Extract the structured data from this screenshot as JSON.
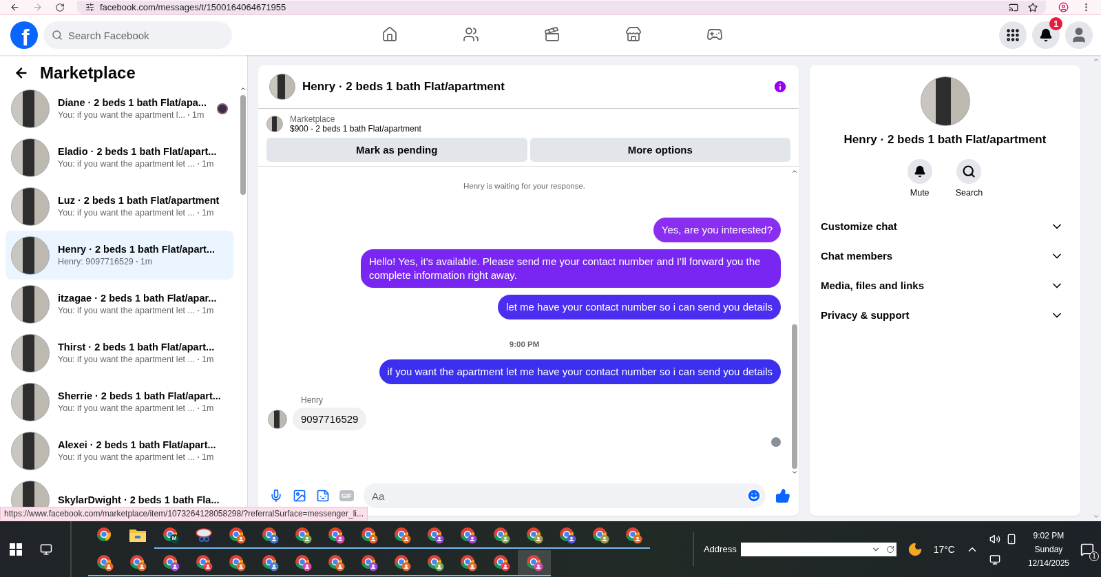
{
  "browser": {
    "url": "facebook.com/messages/t/1500164064671955"
  },
  "topbar": {
    "logo_letter": "f",
    "search": {
      "placeholder": "Search Facebook"
    },
    "nav": [
      {
        "kind": "home",
        "selected": false
      },
      {
        "kind": "friends",
        "selected": false
      },
      {
        "kind": "video",
        "selected": false
      },
      {
        "kind": "marketplace",
        "selected": false
      },
      {
        "kind": "gaming",
        "selected": false
      }
    ],
    "notification_count": "1"
  },
  "sidebar": {
    "title": "Marketplace",
    "items": [
      {
        "title": "Diane · 2 beds 1 bath Flat/apa...",
        "preview": "You: if you want the apartment l...",
        "time": "1m",
        "selected": false,
        "seen": true
      },
      {
        "title": "Eladio · 2 beds 1 bath Flat/apart...",
        "preview": "You: if you want the apartment let ...",
        "time": "1m",
        "selected": false,
        "seen": false
      },
      {
        "title": "Luz · 2 beds 1 bath Flat/apartment",
        "preview": "You: if you want the apartment let ...",
        "time": "1m",
        "selected": false,
        "seen": false
      },
      {
        "title": "Henry · 2 beds 1 bath Flat/apart...",
        "preview": "Henry: 9097716529",
        "time": "1m",
        "selected": true,
        "seen": false
      },
      {
        "title": "itzagae · 2 beds 1 bath Flat/apar...",
        "preview": "You: if you want the apartment let ...",
        "time": "1m",
        "selected": false,
        "seen": false
      },
      {
        "title": "Thirst · 2 beds 1 bath Flat/apart...",
        "preview": "You: if you want the apartment let ...",
        "time": "1m",
        "selected": false,
        "seen": false
      },
      {
        "title": "Sherrie · 2 beds 1 bath Flat/apart...",
        "preview": "You: if you want the apartment let ...",
        "time": "1m",
        "selected": false,
        "seen": false
      },
      {
        "title": "Alexei · 2 beds 1 bath Flat/apart...",
        "preview": "You: if you want the apartment let ...",
        "time": "1m",
        "selected": false,
        "seen": false
      },
      {
        "title": "SkylarDwight · 2 beds 1 bath Fla...",
        "selected": false,
        "seen": false
      }
    ]
  },
  "chat": {
    "title": "Henry · 2 beds 1 bath Flat/apartment",
    "listing": {
      "source": "Marketplace",
      "summary": "$900 - 2 beds 1 bath Flat/apartment"
    },
    "buttons": [
      "Mark as pending",
      "More options"
    ],
    "messages": [
      {
        "kind": "note",
        "text": "Henry is waiting for your response."
      },
      {
        "kind": "outgoing",
        "text": "Yes, are you interested?",
        "color": "#8a2ff0"
      },
      {
        "kind": "outgoing",
        "text": "Hello! Yes, it’s available. Please send me your contact number and I’ll forward you the complete information right away.",
        "color": "#7a26f2"
      },
      {
        "kind": "outgoing",
        "text": "let me have your contact number so i can send you details",
        "color": "#4b2ef0"
      },
      {
        "kind": "time",
        "text": "9:00 PM"
      },
      {
        "kind": "outgoing",
        "text": "if you want the apartment let me have your contact number so i can send you details",
        "color": "#3a30ee"
      },
      {
        "kind": "incoming",
        "sender": "Henry",
        "text": "9097716529"
      }
    ],
    "composer": {
      "gif_label": "GIF",
      "placeholder": "Aa"
    }
  },
  "details": {
    "name": "Henry · 2 beds 1 bath Flat/apartment",
    "actions": [
      {
        "kind": "mute",
        "label": "Mute"
      },
      {
        "kind": "search",
        "label": "Search"
      }
    ],
    "sections": [
      {
        "label": "Customize chat",
        "expanded": false
      },
      {
        "label": "Chat members",
        "expanded": false
      },
      {
        "label": "Media, files and links",
        "expanded": false
      },
      {
        "label": "Privacy & support",
        "expanded": false
      }
    ]
  },
  "status_url": "https://www.facebook.com/marketplace/item/1073264128058298/?referralSurface=messenger_li...",
  "taskbar": {
    "row_1": [
      {
        "kind": "chrome"
      },
      {
        "kind": "folder"
      },
      {
        "kind": "chrome-m",
        "label": "M"
      },
      {
        "kind": "snip"
      },
      {
        "kind": "profile",
        "color": "#e8662a"
      },
      {
        "kind": "profile",
        "color": "#4a78d8"
      },
      {
        "kind": "profile",
        "color": "#7aa85a"
      },
      {
        "kind": "profile",
        "color": "#d848a8"
      },
      {
        "kind": "profile",
        "color": "#e8662a"
      },
      {
        "kind": "profile",
        "color": "#e8662a"
      },
      {
        "kind": "profile",
        "color": "#9a48d8"
      },
      {
        "kind": "profile",
        "color": "#9a48d8"
      },
      {
        "kind": "profile",
        "color": "#7aa85a"
      },
      {
        "kind": "profile",
        "color": "#a89a48"
      },
      {
        "kind": "profile",
        "color": "#5a58d8"
      },
      {
        "kind": "profile",
        "color": "#a89a48"
      },
      {
        "kind": "profile",
        "color": "#e8662a"
      }
    ],
    "row_2": [
      {
        "kind": "profile",
        "color": "#e8662a"
      },
      {
        "kind": "profile",
        "color": "#e8662a"
      },
      {
        "kind": "profile",
        "color": "#9a48d8"
      },
      {
        "kind": "profile",
        "color": "#e83a4a"
      },
      {
        "kind": "profile",
        "color": "#e8662a"
      },
      {
        "kind": "profile",
        "color": "#4a78d8"
      },
      {
        "kind": "profile",
        "color": "#d848a8"
      },
      {
        "kind": "profile",
        "color": "#e8662a"
      },
      {
        "kind": "profile",
        "color": "#9a48d8"
      },
      {
        "kind": "profile",
        "color": "#e8662a"
      },
      {
        "kind": "profile",
        "color": "#7aa85a"
      },
      {
        "kind": "profile",
        "color": "#e8662a"
      },
      {
        "kind": "profile",
        "color": "#e83a4a"
      },
      {
        "kind": "profile",
        "color": "#d848a8"
      }
    ],
    "address_label": "Address",
    "temperature": "17°C",
    "time": "9:02 PM",
    "day": "Sunday",
    "date": "12/14/2025",
    "notification_count": "1"
  }
}
